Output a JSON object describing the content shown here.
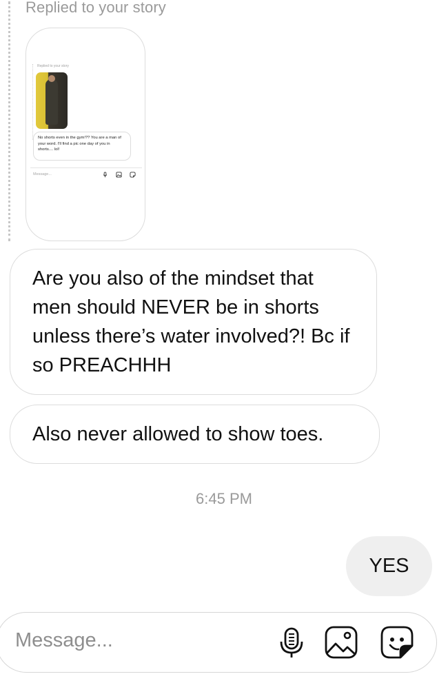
{
  "reply_header": "Replied to your story",
  "story_preview": {
    "header": "Replied to your story",
    "bubble_text": "No shorts even in the gym!?? You are a man of your word. I'll find a pic one day of you in shorts.... lol!",
    "input_placeholder": "Message..."
  },
  "messages": [
    {
      "direction": "received",
      "text": "Are you also of the mindset that men should NEVER be in shorts unless there’s water involved?! Bc if so PREACHHH"
    },
    {
      "direction": "received",
      "text": "Also never allowed to show toes."
    }
  ],
  "timestamp": "6:45 PM",
  "sent_message": "YES",
  "composer": {
    "placeholder": "Message...",
    "icons": [
      "microphone-icon",
      "image-icon",
      "sticker-icon"
    ]
  },
  "colors": {
    "bubble_border": "#dcdcdc",
    "sent_bubble_bg": "#efefef",
    "muted_text": "#9a9a9a"
  }
}
